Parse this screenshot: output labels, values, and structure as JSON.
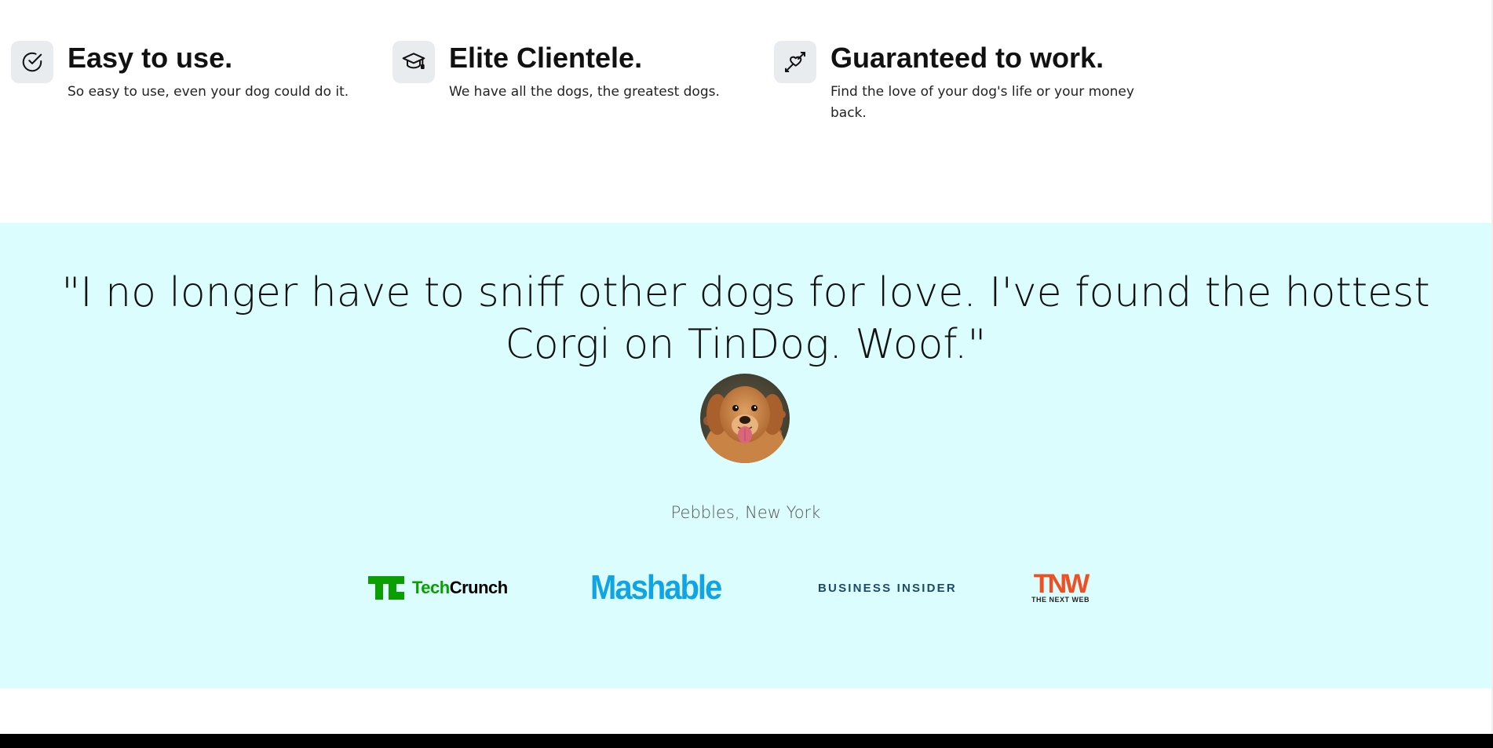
{
  "features": [
    {
      "title": "Easy to use.",
      "description": "So easy to use, even your dog could do it.",
      "icon": "check-circle-icon"
    },
    {
      "title": "Elite Clientele.",
      "description": "We have all the dogs, the greatest dogs.",
      "icon": "graduation-cap-icon"
    },
    {
      "title": "Guaranteed to work.",
      "description": "Find the love of your dog's life or your money back.",
      "icon": "heart-arrow-icon"
    }
  ],
  "testimonial": {
    "quote": "\"I no longer have to sniff other dogs for love. I've found the hottest Corgi on TinDog. Woof.\"",
    "author": "Pebbles, New York",
    "avatar": "dog-avatar-image"
  },
  "press": [
    {
      "name": "TechCrunch",
      "mark": "TC",
      "text": "TechCrunch"
    },
    {
      "name": "Mashable",
      "text": "Mashable"
    },
    {
      "name": "Business Insider",
      "text": "BUSINESS INSIDER"
    },
    {
      "name": "The Next Web",
      "mark": "TNW",
      "text": "THE NEXT WEB"
    }
  ],
  "colors": {
    "testimonial_bg": "#dcfdfd",
    "techcrunch_green": "#0a9e01",
    "mashable_blue": "#0ea4e6",
    "business_insider_navy": "#1b4a6b",
    "tnw_red": "#f04e23",
    "icon_box_bg": "#e9ecef"
  }
}
